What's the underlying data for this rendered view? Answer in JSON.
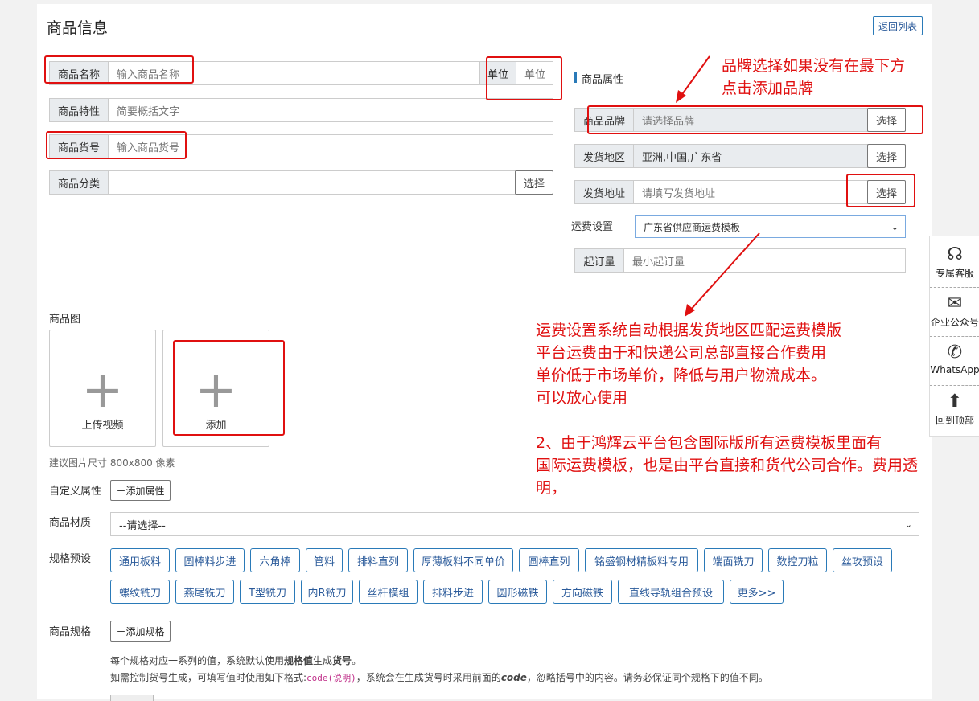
{
  "page": {
    "title": "商品信息",
    "back_label": "返回列表"
  },
  "left_form": {
    "name_label": "商品名称",
    "name_placeholder": "输入商品名称",
    "unit_label": "单位",
    "unit_placeholder": "单位",
    "feature_label": "商品特性",
    "feature_placeholder": "简要概括文字",
    "code_label": "商品货号",
    "code_placeholder": "输入商品货号",
    "category_label": "商品分类",
    "category_button": "选择"
  },
  "attributes": {
    "section_title": "商品属性",
    "brand_label": "商品品牌",
    "brand_placeholder": "请选择品牌",
    "brand_button": "选择",
    "region_label": "发货地区",
    "region_value": "亚洲,中国,广东省",
    "region_button": "选择",
    "address_label": "发货地址",
    "address_placeholder": "请填写发货地址",
    "address_button": "选择",
    "freight_label": "运费设置",
    "freight_value": "广东省供应商运费模板",
    "moq_label": "起订量",
    "moq_placeholder": "最小起订量"
  },
  "images": {
    "label": "商品图",
    "upload_video": "上传视频",
    "add": "添加",
    "hint": "建议图片尺寸 800x800 像素"
  },
  "custom": {
    "label": "自定义属性",
    "button": "＋添加属性"
  },
  "material": {
    "label": "商品材质",
    "value": "--请选择--"
  },
  "presets": {
    "label": "规格预设",
    "row1": [
      "通用板料",
      "圆棒料步进",
      "六角棒",
      "管料",
      "排料直列",
      "厚薄板料不同单价",
      "圆棒直列",
      "铭盛钢材精板料专用",
      "端面铣刀",
      "数控刀粒",
      "丝攻预设"
    ],
    "row2": [
      "螺纹铣刀",
      "燕尾铣刀",
      "T型铣刀",
      "内R铣刀",
      "丝杆模组",
      "排料步进",
      "圆形磁铁",
      "方向磁铁",
      "直线导轨组合预设",
      "更多>>"
    ]
  },
  "spec": {
    "label": "商品规格",
    "button": "＋添加规格",
    "help1_a": "每个规格对应一系列的值，系统默认使用",
    "help1_b": "规格值",
    "help1_c": "生成",
    "help1_d": "货号",
    "help1_e": "。",
    "help2_a": "如需控制货号生成，可填写值时使用如下格式:",
    "help2_code": "code(说明)",
    "help2_b": "，系统会在生成货号时采用前面的",
    "help2_c": "code",
    "help2_d": "，忽略括号中的内容。请务必保证同个规格下的值不同。"
  },
  "annotations": {
    "brand_note_1": "品牌选择如果没有在最下方",
    "brand_note_2": "点击添加品牌",
    "freight_note_1": "运费设置系统自动根据发货地区匹配运费模版",
    "freight_note_2": "平台运费由于和快递公司总部直接合作费用",
    "freight_note_3": "单价低于市场单价，降低与用户物流成本。",
    "freight_note_4": "可以放心使用",
    "freight_note_5": "2、由于鸿辉云平台包含国际版所有运费模板里面有",
    "freight_note_6": "国际运费模板，也是由平台直接和货代公司合作。费用透",
    "freight_note_7": "明，"
  },
  "sidebar": {
    "service": "专属客服",
    "wechat": "企业公众号",
    "whatsapp": "WhatsApp",
    "top": "回到顶部"
  },
  "colors": {
    "accent": "#2a7ab8",
    "annotation": "#e01010"
  }
}
